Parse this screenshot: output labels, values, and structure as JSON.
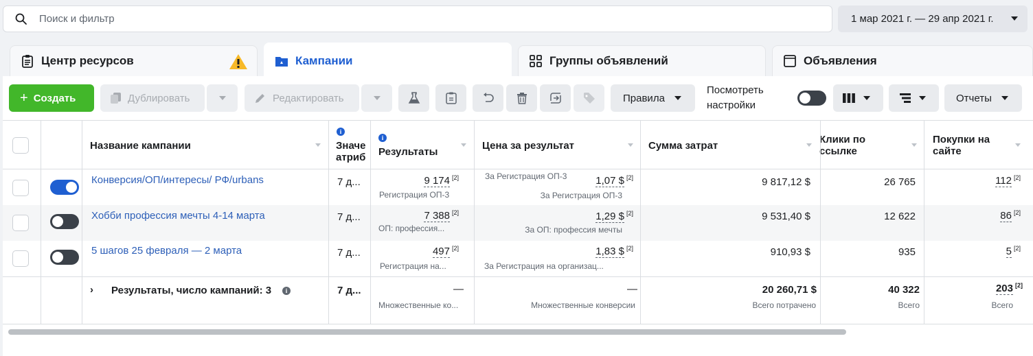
{
  "search": {
    "placeholder": "Поиск и фильтр"
  },
  "date_range": "1 мар 2021 г. — 29 апр 2021 г.",
  "tabs": [
    {
      "label": "Центр ресурсов"
    },
    {
      "label": "Кампании"
    },
    {
      "label": "Группы объявлений"
    },
    {
      "label": "Объявления"
    }
  ],
  "toolbar": {
    "create": "Создать",
    "duplicate": "Дублировать",
    "edit": "Редактировать",
    "rules": "Правила",
    "view_settings_line1": "Посмотреть",
    "view_settings_line2": "настройки",
    "reports": "Отчеты"
  },
  "columns": {
    "name": "Название кампании",
    "attr_line1": "Значе",
    "attr_line2": "атриб",
    "results": "Результаты",
    "cpr": "Цена за результат",
    "spend": "Сумма затрат",
    "clicks_line1": "Клики по",
    "clicks_line2": "ссылке",
    "purchases_line1": "Покупки на",
    "purchases_line2": "сайте"
  },
  "rows": [
    {
      "name": "Конверсия/ОП/интересы/ РФ/urbans",
      "active": true,
      "attr": "7 д...",
      "results": "9 174",
      "results_note": "[2]",
      "results_sub": "Регистрация ОП-3",
      "cpr_top": "За Регистрация ОП-3",
      "cpr": "1,07 $",
      "cpr_note": "[2]",
      "cpr_sub": "За Регистрация ОП-3",
      "spend": "9 817,12 $",
      "clicks": "26 765",
      "purchases": "112",
      "purchases_note": "[2]"
    },
    {
      "name": "Хобби профессия мечты 4-14 марта",
      "active": false,
      "attr": "7 д...",
      "results": "7 388",
      "results_note": "[2]",
      "results_sub": "ОП: профессия...",
      "cpr_top": "",
      "cpr": "1,29 $",
      "cpr_note": "[2]",
      "cpr_sub": "За ОП: профессия мечты",
      "spend": "9 531,40 $",
      "clicks": "12 622",
      "purchases": "86",
      "purchases_note": "[2]"
    },
    {
      "name": "5 шагов 25 февраля — 2 марта",
      "active": false,
      "attr": "7 д...",
      "results": "497",
      "results_note": "[2]",
      "results_sub": "Регистрация на...",
      "cpr_top": "",
      "cpr": "1,83 $",
      "cpr_note": "[2]",
      "cpr_sub": "За Регистрация на организац...",
      "spend": "910,93 $",
      "clicks": "935",
      "purchases": "5",
      "purchases_note": "[2]"
    }
  ],
  "summary": {
    "label": "Результаты, число кампаний: 3",
    "attr": "7 д...",
    "results": "—",
    "results_sub": "Множественные ко...",
    "cpr": "—",
    "cpr_sub": "Множественные конверсии",
    "spend": "20 260,71 $",
    "spend_sub": "Всего потрачено",
    "clicks": "40 322",
    "clicks_sub": "Всего",
    "purchases": "203",
    "purchases_note": "[2]",
    "purchases_sub": "Всего"
  }
}
